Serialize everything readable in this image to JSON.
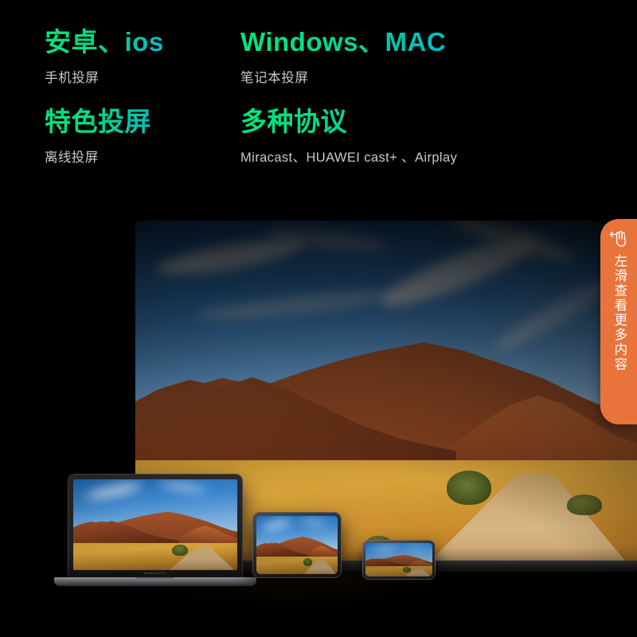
{
  "features": [
    {
      "id": "android-ios",
      "title": "安卓、ios",
      "subtitle": "手机投屏"
    },
    {
      "id": "windows-mac",
      "title": "Windows、MAC",
      "subtitle": "笔记本投屏"
    },
    {
      "id": "special-cast",
      "title": "特色投屏",
      "subtitle": "离线投屏"
    },
    {
      "id": "protocols",
      "title": "多种协议",
      "subtitle": "Miracast、HUAWEI cast+ 、Airplay"
    }
  ],
  "swipe_tab": {
    "icon": "swipe-left-hand-icon",
    "label": "左滑查看更多内容",
    "color": "#E8743B"
  },
  "devices": [
    {
      "id": "tv",
      "name": "television",
      "logo_label": ""
    },
    {
      "id": "laptop",
      "name": "macbook-pro",
      "logo_label": "MacBook Pro"
    },
    {
      "id": "tablet",
      "name": "tablet",
      "logo_label": ""
    },
    {
      "id": "phone",
      "name": "smartphone",
      "logo_label": ""
    }
  ],
  "scene": {
    "description": "desert-landscape-photo",
    "sky_color": "#3d86cc",
    "rock_color": "#a4532a",
    "grass_color": "#d7a23a"
  },
  "colors": {
    "background": "#000000",
    "title_gradient_start": "#00E87A",
    "title_gradient_end": "#1C9BF5",
    "subtitle": "#C9C9C9",
    "accent_orange": "#E8743B"
  }
}
